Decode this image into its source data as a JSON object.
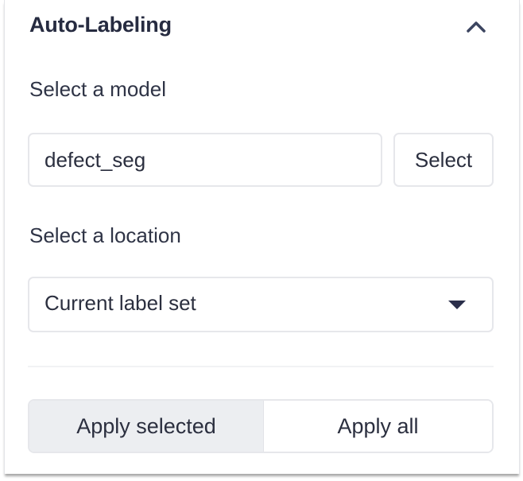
{
  "panel": {
    "title": "Auto-Labeling",
    "collapse_icon": "chevron-up-icon"
  },
  "model": {
    "label": "Select a model",
    "input_value": "defect_seg",
    "select_button": "Select"
  },
  "location": {
    "label": "Select a location",
    "selected_value": "Current label set",
    "dropdown_icon": "caret-down-icon"
  },
  "actions": {
    "apply_selected": "Apply selected",
    "apply_all": "Apply all",
    "active": "apply_selected"
  },
  "colors": {
    "text": "#2b2f3f",
    "border": "#e6e7eb",
    "active_segment_bg": "#eceef1"
  }
}
